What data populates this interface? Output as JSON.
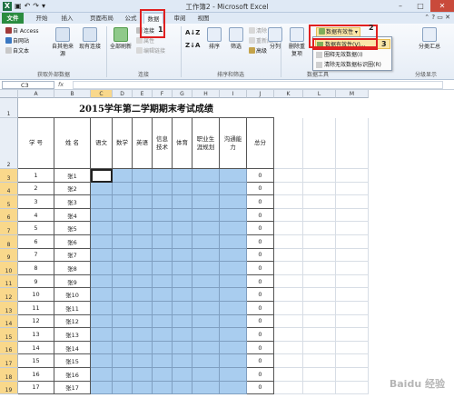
{
  "window": {
    "title": "工作簿2 - Microsoft Excel",
    "app_badge": "X"
  },
  "tabs": [
    "文件",
    "开始",
    "插入",
    "页面布局",
    "公式",
    "数据",
    "审阅",
    "视图"
  ],
  "ribbon": {
    "get_external": {
      "label": "获取外部数据",
      "items": [
        "自 Access",
        "自网站",
        "自文本",
        "自其他来源",
        "现有连接"
      ]
    },
    "connections": {
      "label": "连接",
      "items": [
        "全部刷新",
        "连接",
        "属性",
        "编辑链接"
      ]
    },
    "sort_filter": {
      "label": "排序和筛选",
      "items": [
        "排序",
        "筛选",
        "清除",
        "重新应用",
        "高级"
      ]
    },
    "data_tools": {
      "label": "数据工具",
      "items": [
        "分列",
        "删除重复项",
        "数据有效性"
      ]
    },
    "outline": {
      "label": "分级显示",
      "items": [
        "分类汇总"
      ]
    }
  },
  "dropdown": {
    "items": [
      "数据有效性(V)...",
      "圈释无效数据(I)",
      "清除无效数据标识圈(R)"
    ],
    "selected_index": 0
  },
  "markers": [
    "1",
    "2",
    "3"
  ],
  "namebox": "C3",
  "fx": "fx",
  "columns": [
    "A",
    "B",
    "C",
    "D",
    "E",
    "F",
    "G",
    "H",
    "I",
    "J",
    "K",
    "L",
    "M"
  ],
  "sheet": {
    "title": "2015学年第二学期期末考试成绩",
    "headers": [
      "学  号",
      "姓  名",
      "语文",
      "数学",
      "英语",
      "信息技术",
      "体育",
      "职业生涯规划",
      "沟通能力",
      "总分"
    ],
    "rows": [
      {
        "rownum": "3",
        "id": "1",
        "name": "张1",
        "total": "0"
      },
      {
        "rownum": "4",
        "id": "2",
        "name": "张2",
        "total": "0"
      },
      {
        "rownum": "5",
        "id": "3",
        "name": "张3",
        "total": "0"
      },
      {
        "rownum": "6",
        "id": "4",
        "name": "张4",
        "total": "0"
      },
      {
        "rownum": "7",
        "id": "5",
        "name": "张5",
        "total": "0"
      },
      {
        "rownum": "8",
        "id": "6",
        "name": "张6",
        "total": "0"
      },
      {
        "rownum": "9",
        "id": "7",
        "name": "张7",
        "total": "0"
      },
      {
        "rownum": "10",
        "id": "8",
        "name": "张8",
        "total": "0"
      },
      {
        "rownum": "11",
        "id": "9",
        "name": "张9",
        "total": "0"
      },
      {
        "rownum": "12",
        "id": "10",
        "name": "张10",
        "total": "0"
      },
      {
        "rownum": "13",
        "id": "11",
        "name": "张11",
        "total": "0"
      },
      {
        "rownum": "14",
        "id": "12",
        "name": "张12",
        "total": "0"
      },
      {
        "rownum": "15",
        "id": "13",
        "name": "张13",
        "total": "0"
      },
      {
        "rownum": "16",
        "id": "14",
        "name": "张14",
        "total": "0"
      },
      {
        "rownum": "17",
        "id": "15",
        "name": "张15",
        "total": "0"
      },
      {
        "rownum": "18",
        "id": "16",
        "name": "张16",
        "total": "0"
      },
      {
        "rownum": "19",
        "id": "17",
        "name": "张17",
        "total": "0"
      }
    ],
    "row_nums_top": [
      "1",
      "2"
    ]
  },
  "watermark": "Baidu 经验",
  "colors": {
    "file_tab": "#2a8c3f",
    "selection_fill": "#a9cdef",
    "red_box": "#e02020",
    "menu_highlight": "#fbe7a8"
  }
}
